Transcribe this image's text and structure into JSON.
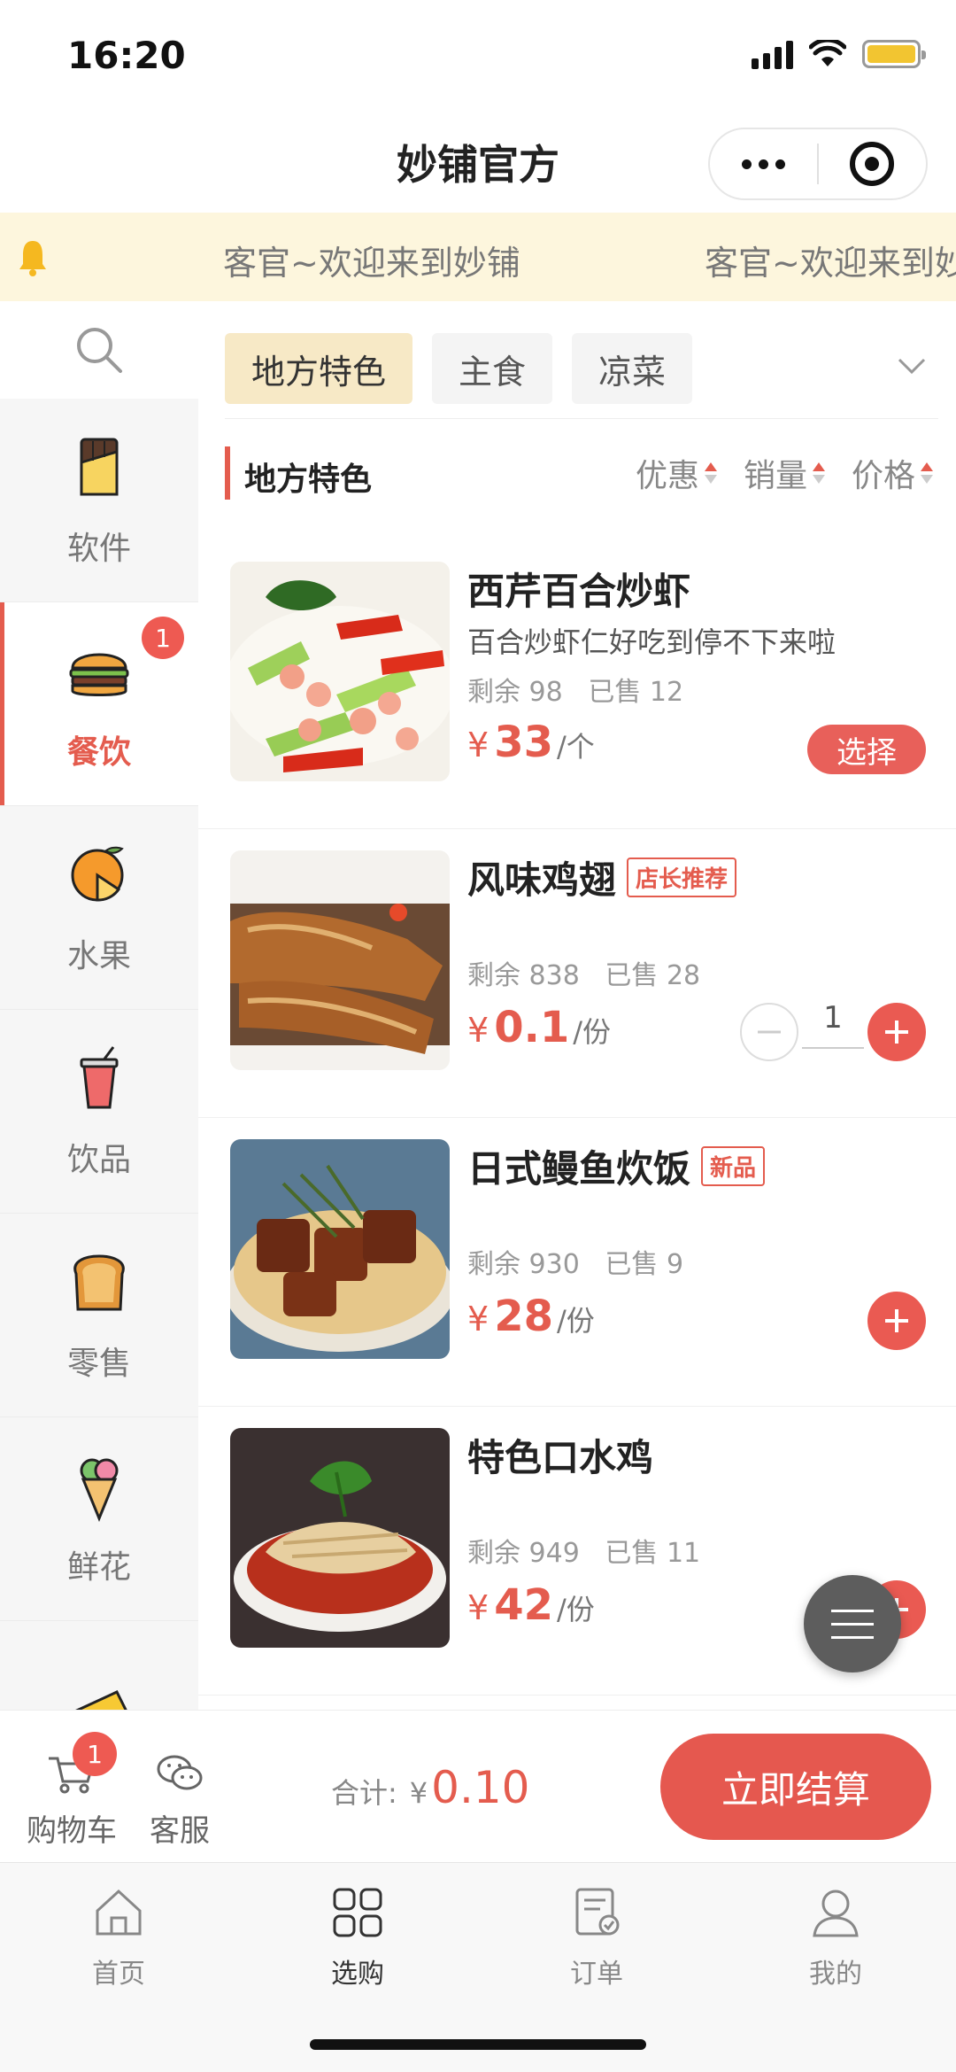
{
  "status_bar": {
    "time": "16:20"
  },
  "header": {
    "title": "妙铺官方"
  },
  "notice": {
    "text": "客官~欢迎来到妙铺",
    "text_repeat": "客官~欢迎来到妙铺"
  },
  "sidebar": {
    "items": [
      {
        "label": "软件",
        "icon": "chocolate-icon"
      },
      {
        "label": "餐饮",
        "icon": "burger-icon",
        "badge": "1",
        "active": true
      },
      {
        "label": "水果",
        "icon": "orange-icon"
      },
      {
        "label": "饮品",
        "icon": "drink-cup-icon"
      },
      {
        "label": "零售",
        "icon": "bread-icon"
      },
      {
        "label": "鲜花",
        "icon": "ice-cream-icon"
      }
    ]
  },
  "tabs": [
    {
      "label": "地方特色",
      "active": true
    },
    {
      "label": "主食"
    },
    {
      "label": "凉菜"
    }
  ],
  "section": {
    "title": "地方特色",
    "sort_discount": "优惠",
    "sort_sales": "销量",
    "sort_price": "价格"
  },
  "products": [
    {
      "name": "西芹百合炒虾",
      "desc": "百合炒虾仁好吃到停不下来啦",
      "stock": "剩余 98",
      "sold": "已售 12",
      "yen": "¥",
      "price": "33",
      "unit": "/个",
      "action": "选择"
    },
    {
      "name": "风味鸡翅",
      "tag": "店长推荐",
      "stock": "剩余 838",
      "sold": "已售 28",
      "yen": "¥",
      "price": "0.1",
      "unit": "/份",
      "qty": "1"
    },
    {
      "name": "日式鳗鱼炊饭",
      "tag": "新品",
      "stock": "剩余 930",
      "sold": "已售 9",
      "yen": "¥",
      "price": "28",
      "unit": "/份"
    },
    {
      "name": "特色口水鸡",
      "stock": "剩余 949",
      "sold": "已售 11",
      "yen": "¥",
      "price": "42",
      "unit": "/份"
    }
  ],
  "checkout": {
    "cart_label": "购物车",
    "cart_badge": "1",
    "service_label": "客服",
    "total_label": "合计:",
    "total_yen": "¥",
    "total_amount": "0.10",
    "pay_label": "立即结算"
  },
  "tabbar": {
    "items": [
      {
        "label": "首页",
        "icon": "home-icon"
      },
      {
        "label": "选购",
        "icon": "grid-icon",
        "active": true
      },
      {
        "label": "订单",
        "icon": "order-icon"
      },
      {
        "label": "我的",
        "icon": "user-icon"
      }
    ]
  },
  "colors": {
    "accent": "#e45c4e",
    "notice_bg": "#fdf6dd",
    "active_tab_bg": "#f7e9c6"
  }
}
